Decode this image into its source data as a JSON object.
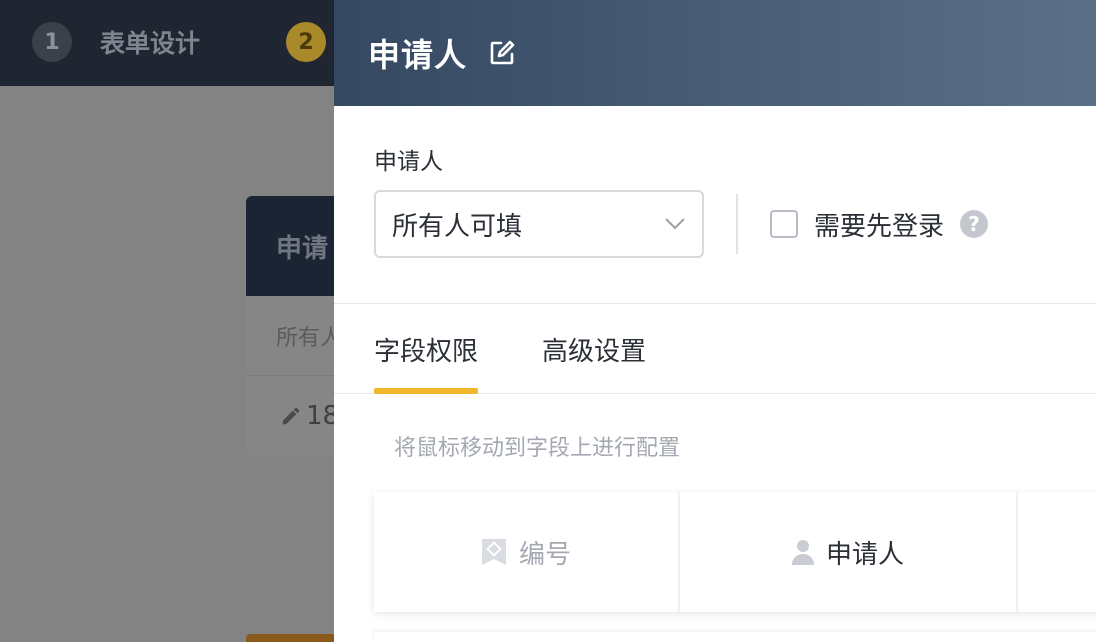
{
  "background": {
    "steps": [
      {
        "number": "1",
        "label": "表单设计"
      },
      {
        "number": "2",
        "label": ""
      }
    ],
    "card": {
      "title": "申请",
      "row_text": "所有人",
      "count_text": "18"
    }
  },
  "drawer": {
    "title": "申请人",
    "section": {
      "label": "申请人",
      "select_value": "所有人可填",
      "checkbox_label": "需要先登录",
      "help_symbol": "?"
    },
    "tabs": [
      {
        "label": "字段权限",
        "active": true
      },
      {
        "label": "高级设置",
        "active": false
      }
    ],
    "hint": "将鼠标移动到字段上进行配置",
    "fields": [
      {
        "label": "编号",
        "icon": "flag-icon"
      },
      {
        "label": "申请人",
        "icon": "user-icon"
      }
    ]
  },
  "colors": {
    "header_gradient_start": "#354862",
    "header_gradient_end": "#5b6f88",
    "tab_active_underline": "#f1b72a",
    "step2_badge": "#a9892a"
  }
}
